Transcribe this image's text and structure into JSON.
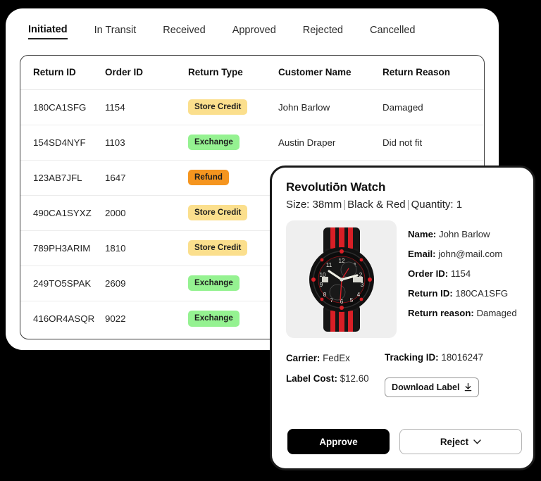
{
  "tabs": [
    {
      "label": "Initiated",
      "active": true
    },
    {
      "label": "In Transit",
      "active": false
    },
    {
      "label": "Received",
      "active": false
    },
    {
      "label": "Approved",
      "active": false
    },
    {
      "label": "Rejected",
      "active": false
    },
    {
      "label": "Cancelled",
      "active": false
    }
  ],
  "table": {
    "headers": [
      "Return ID",
      "Order ID",
      "Return Type",
      "Customer Name",
      "Return Reason"
    ],
    "rows": [
      {
        "return_id": "180CA1SFG",
        "order_id": "1154",
        "return_type": "Store Credit",
        "type_key": "store-credit",
        "customer": "John Barlow",
        "reason": "Damaged"
      },
      {
        "return_id": "154SD4NYF",
        "order_id": "1103",
        "return_type": "Exchange",
        "type_key": "exchange",
        "customer": "Austin Draper",
        "reason": "Did not fit"
      },
      {
        "return_id": "123AB7JFL",
        "order_id": "1647",
        "return_type": "Refund",
        "type_key": "refund",
        "customer": "",
        "reason": ""
      },
      {
        "return_id": "490CA1SYXZ",
        "order_id": "2000",
        "return_type": "Store Credit",
        "type_key": "store-credit",
        "customer": "",
        "reason": ""
      },
      {
        "return_id": "789PH3ARIM",
        "order_id": "1810",
        "return_type": "Store Credit",
        "type_key": "store-credit",
        "customer": "",
        "reason": ""
      },
      {
        "return_id": "249TO5SPAK",
        "order_id": "2609",
        "return_type": "Exchange",
        "type_key": "exchange",
        "customer": "",
        "reason": ""
      },
      {
        "return_id": "416OR4ASQR",
        "order_id": "9022",
        "return_type": "Exchange",
        "type_key": "exchange",
        "customer": "",
        "reason": ""
      }
    ]
  },
  "detail": {
    "product_title": "Revolutiōn Watch",
    "size_label": "Size: 38mm",
    "color_label": "Black & Red",
    "quantity_label": "Quantity: 1",
    "product_image_alt": "black-red-chronograph-watch",
    "info": [
      {
        "label": "Name:",
        "value": "John Barlow"
      },
      {
        "label": "Email:",
        "value": "john@mail.com"
      },
      {
        "label": "Order ID:",
        "value": "1154"
      },
      {
        "label": "Return ID:",
        "value": "180CA1SFG"
      },
      {
        "label": "Return reason:",
        "value": "Damaged"
      }
    ],
    "shipping": {
      "carrier_label": "Carrier:",
      "carrier_value": "FedEx",
      "label_cost_label": "Label Cost:",
      "label_cost_value": "$12.60",
      "tracking_label": "Tracking ID:",
      "tracking_value": "18016247",
      "download_label": "Download Label"
    },
    "actions": {
      "approve": "Approve",
      "reject": "Reject"
    }
  },
  "colors": {
    "store_credit": "#fbdf8d",
    "exchange": "#95f291",
    "refund": "#f5951f",
    "approve_bg": "#000000",
    "panel_bg": "#ffffff",
    "page_bg": "#000000"
  }
}
